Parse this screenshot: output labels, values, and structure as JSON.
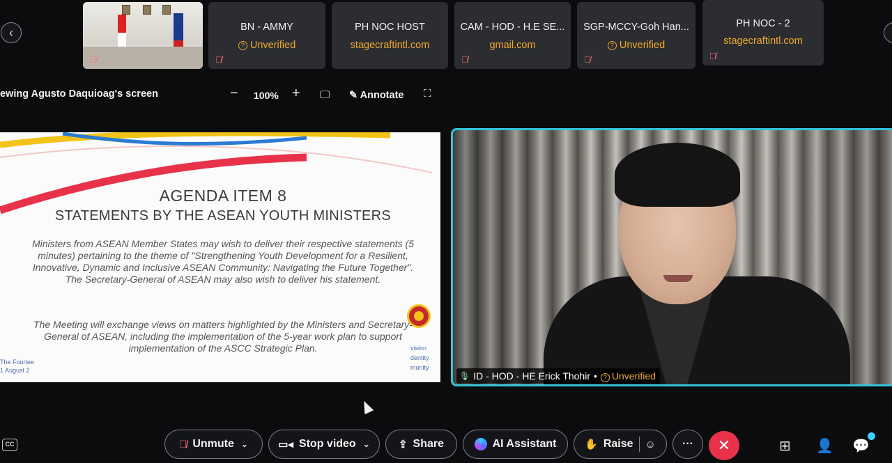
{
  "participants": [
    {
      "name": "BN - AMMY",
      "status": "Unverified",
      "status_icon": "warning-icon"
    },
    {
      "name": "PH NOC HOST",
      "status": "stagecraftintl.com"
    },
    {
      "name": "CAM - HOD - H.E SE...",
      "status": "gmail.com"
    },
    {
      "name": "SGP-MCCY-Goh Han...",
      "status": "Unverified",
      "status_icon": "warning-icon"
    },
    {
      "name": "PH NOC - 2",
      "status": "stagecraftintl.com"
    }
  ],
  "colors": {
    "status_warning": "#f0a82d",
    "muted": "#ff6b7d",
    "active_speaker_border": "#33c4d8",
    "end_call": "#e8324a"
  },
  "share_toolbar": {
    "viewing_label": "iewing Agusto Daquioag's screen",
    "zoom_out": "−",
    "zoom_level": "100%",
    "zoom_in": "+",
    "annotate_label": "Annotate"
  },
  "slide": {
    "title": "AGENDA ITEM 8",
    "subtitle": "STATEMENTS BY THE ASEAN YOUTH MINISTERS",
    "paragraph1": "Ministers from ASEAN Member States may wish to deliver their respective statements (5 minutes) pertaining to the theme of \"Strengthening Youth Development for a Resilient, Innovative, Dynamic and Inclusive ASEAN Community: Navigating the Future Together\". The Secretary-General of ASEAN may also wish to deliver his statement.",
    "paragraph2": "The Meeting will exchange views on matters highlighted by the Ministers and Secretary-General of ASEAN, including the implementation of the 5-year work plan to support implementation of the ASCC Strategic Plan.",
    "footer_line1": "The Fourtee",
    "footer_line2": "1 August 2",
    "motto_line1": "vision",
    "motto_line2": "dentity",
    "motto_line3": "munity"
  },
  "speaker": {
    "name": "ID - HOD - HE Erick Thohir",
    "separator": "•",
    "status": "Unverified"
  },
  "controls": {
    "cc_label": "CC",
    "unmute_label": "Unmute",
    "stop_video_label": "Stop video",
    "share_label": "Share",
    "ai_assistant_label": "AI Assistant",
    "raise_label": "Raise",
    "more_label": "···"
  }
}
